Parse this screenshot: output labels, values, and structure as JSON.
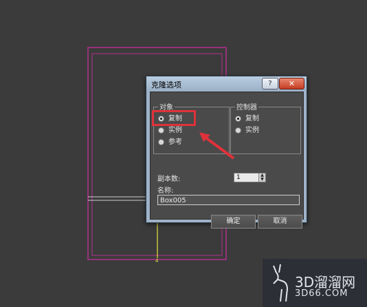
{
  "dialog": {
    "title": "克隆选项",
    "help_label": "?",
    "close_label": "✕",
    "object_group": {
      "label": "对象",
      "options": [
        {
          "label": "复制",
          "selected": true
        },
        {
          "label": "实例",
          "selected": false
        },
        {
          "label": "参考",
          "selected": false
        }
      ]
    },
    "controller_group": {
      "label": "控制器",
      "options": [
        {
          "label": "复制",
          "selected": true
        },
        {
          "label": "实例",
          "selected": false
        }
      ]
    },
    "copies_label": "副本数:",
    "copies_value": "1",
    "name_label": "名称:",
    "name_value": "Box005",
    "ok_label": "确定",
    "cancel_label": "取消"
  },
  "watermark": {
    "brand": "3D溜溜网",
    "url": "3D66.COM"
  },
  "colors": {
    "wireframe": "#b5308f",
    "highlight": "#e0313a",
    "axis": "#e6e63a"
  }
}
